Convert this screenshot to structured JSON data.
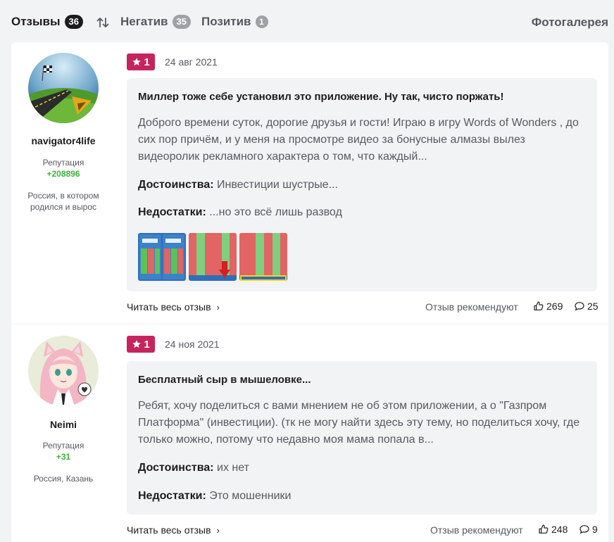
{
  "tabs": {
    "reviews": {
      "label": "Отзывы",
      "count": "36"
    },
    "negative": {
      "label": "Негатив",
      "count": "35"
    },
    "positive": {
      "label": "Позитив",
      "count": "1"
    },
    "gallery": "Фотогалерея"
  },
  "common": {
    "reputation_label": "Репутация",
    "read_more": "Читать весь отзыв",
    "recommend_label": "Отзыв рекомендуют",
    "pros_label": "Достоинства:",
    "cons_label": "Недостатки:"
  },
  "reviews": [
    {
      "user": "navigator4life",
      "reputation": "+208896",
      "location": "Россия, в котором родился и вырос",
      "rating": "1",
      "date": "24 авг 2021",
      "title": "Миллер тоже себе установил это приложение. Ну так, чисто поржать!",
      "excerpt": "Доброго времени суток, дорогие друзья и гости! Играю в игру Words of Wonders , до сих пор причём, и у меня на просмотре видео за бонусные алмазы вылез видеоролик рекламного характера о том, что каждый...",
      "pros": "Инвестиции шустрые...",
      "cons": "...но это всё лишь развод",
      "likes": "269",
      "comments": "25"
    },
    {
      "user": "Neimi",
      "reputation": "+31",
      "location": "Россия, Казань",
      "rating": "1",
      "date": "24 ноя 2021",
      "title": "Бесплатный сыр в мышеловке...",
      "excerpt": "Ребят, хочу поделиться с вами мнением не об этом приложении, а о \"Газпром Платформа\" (инвестиции). (тк не могу найти здесь эту тему, но поделиться хочу, где только можно, потому что недавно моя мама попала в...",
      "pros": "их нет",
      "cons": "Это мошенники",
      "likes": "248",
      "comments": "9"
    }
  ],
  "colors": {
    "rating_badge": "#c6245c",
    "reputation": "#3bb33b",
    "page_bg": "#f2f3f5"
  }
}
